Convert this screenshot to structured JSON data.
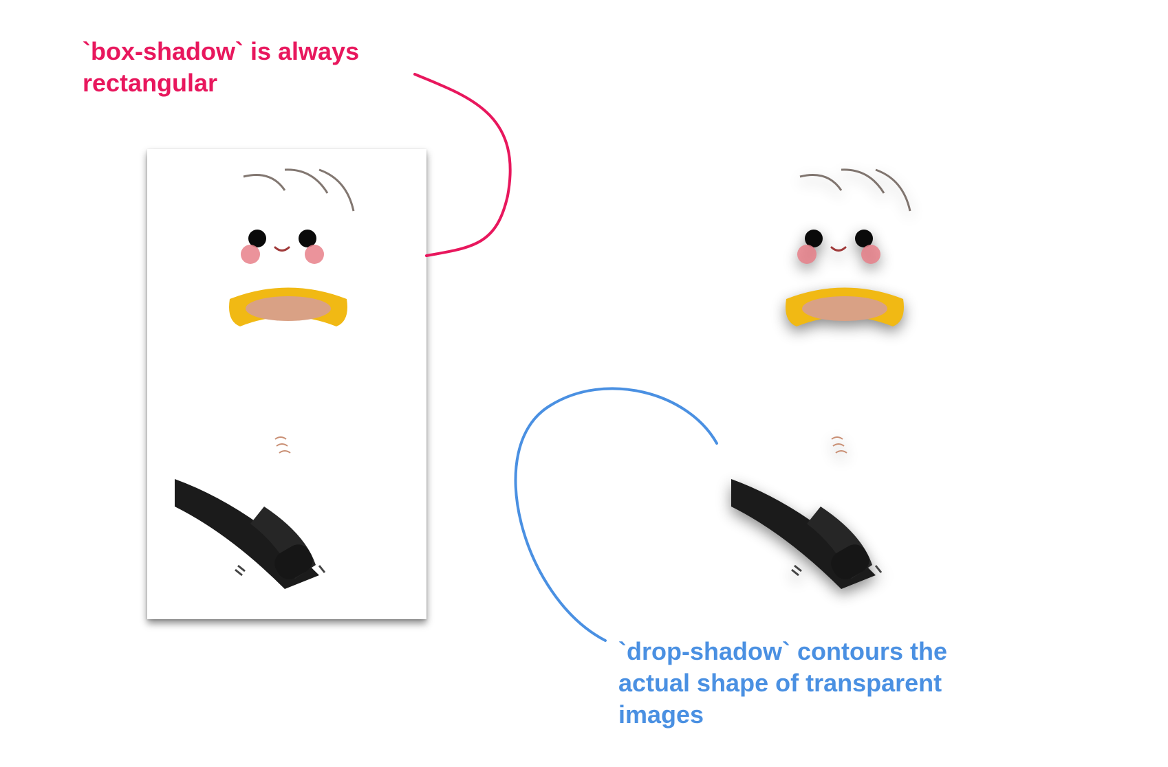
{
  "annotations": {
    "box_shadow": {
      "line1": "`box-shadow` is always",
      "line2": "rectangular",
      "color": "#e8175d"
    },
    "drop_shadow": {
      "line1": "`drop-shadow` contours the",
      "line2": "actual shape of transparent",
      "line3": "images",
      "color": "#4a90e2"
    }
  },
  "figures": {
    "left": {
      "shadow_type": "box-shadow"
    },
    "right": {
      "shadow_type": "drop-shadow"
    }
  },
  "colors": {
    "hair": "#5a3a2a",
    "skin": "#f2cbb0",
    "cheeks": "#e8808a",
    "hoodie": "#f5c518",
    "shirt": "#dcdcdc",
    "pants": "#1f1f1f",
    "shoes": "#f4f4f4"
  }
}
